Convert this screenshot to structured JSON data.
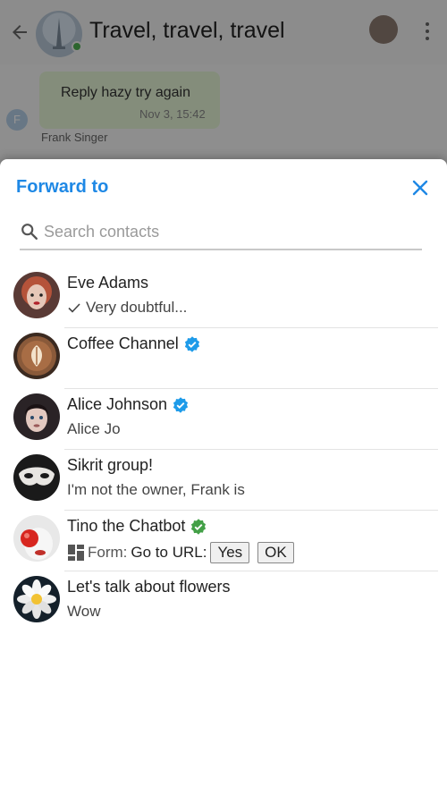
{
  "background": {
    "chat_title": "Travel, travel, travel",
    "message_text": "Reply hazy try again",
    "message_time": "Nov 3, 15:42",
    "sender_initial": "F",
    "sender_name": "Frank Singer"
  },
  "sheet": {
    "title": "Forward to",
    "search_placeholder": "Search contacts",
    "search_value": ""
  },
  "contacts": [
    {
      "name": "Eve Adams",
      "preview": "Very doubtful...",
      "read": true,
      "verified": false
    },
    {
      "name": "Coffee Channel",
      "preview": "",
      "verified": true,
      "badge_color": "#1e9be9"
    },
    {
      "name": "Alice Johnson",
      "preview": "Alice Jo",
      "verified": true,
      "badge_color": "#1e9be9"
    },
    {
      "name": "Sikrit group!",
      "preview": "I'm not the owner, Frank is",
      "verified": false
    },
    {
      "name": "Tino the Chatbot",
      "verified": true,
      "badge_color": "#43a047",
      "form": {
        "label": "Form:",
        "text": "Go to URL:",
        "buttons": [
          "Yes",
          "OK"
        ]
      }
    },
    {
      "name": "Let's talk about flowers",
      "preview": "Wow",
      "verified": false
    }
  ],
  "colors": {
    "accent": "#1e88e5",
    "verified_blue": "#1e9be9",
    "verified_green": "#43a047"
  }
}
